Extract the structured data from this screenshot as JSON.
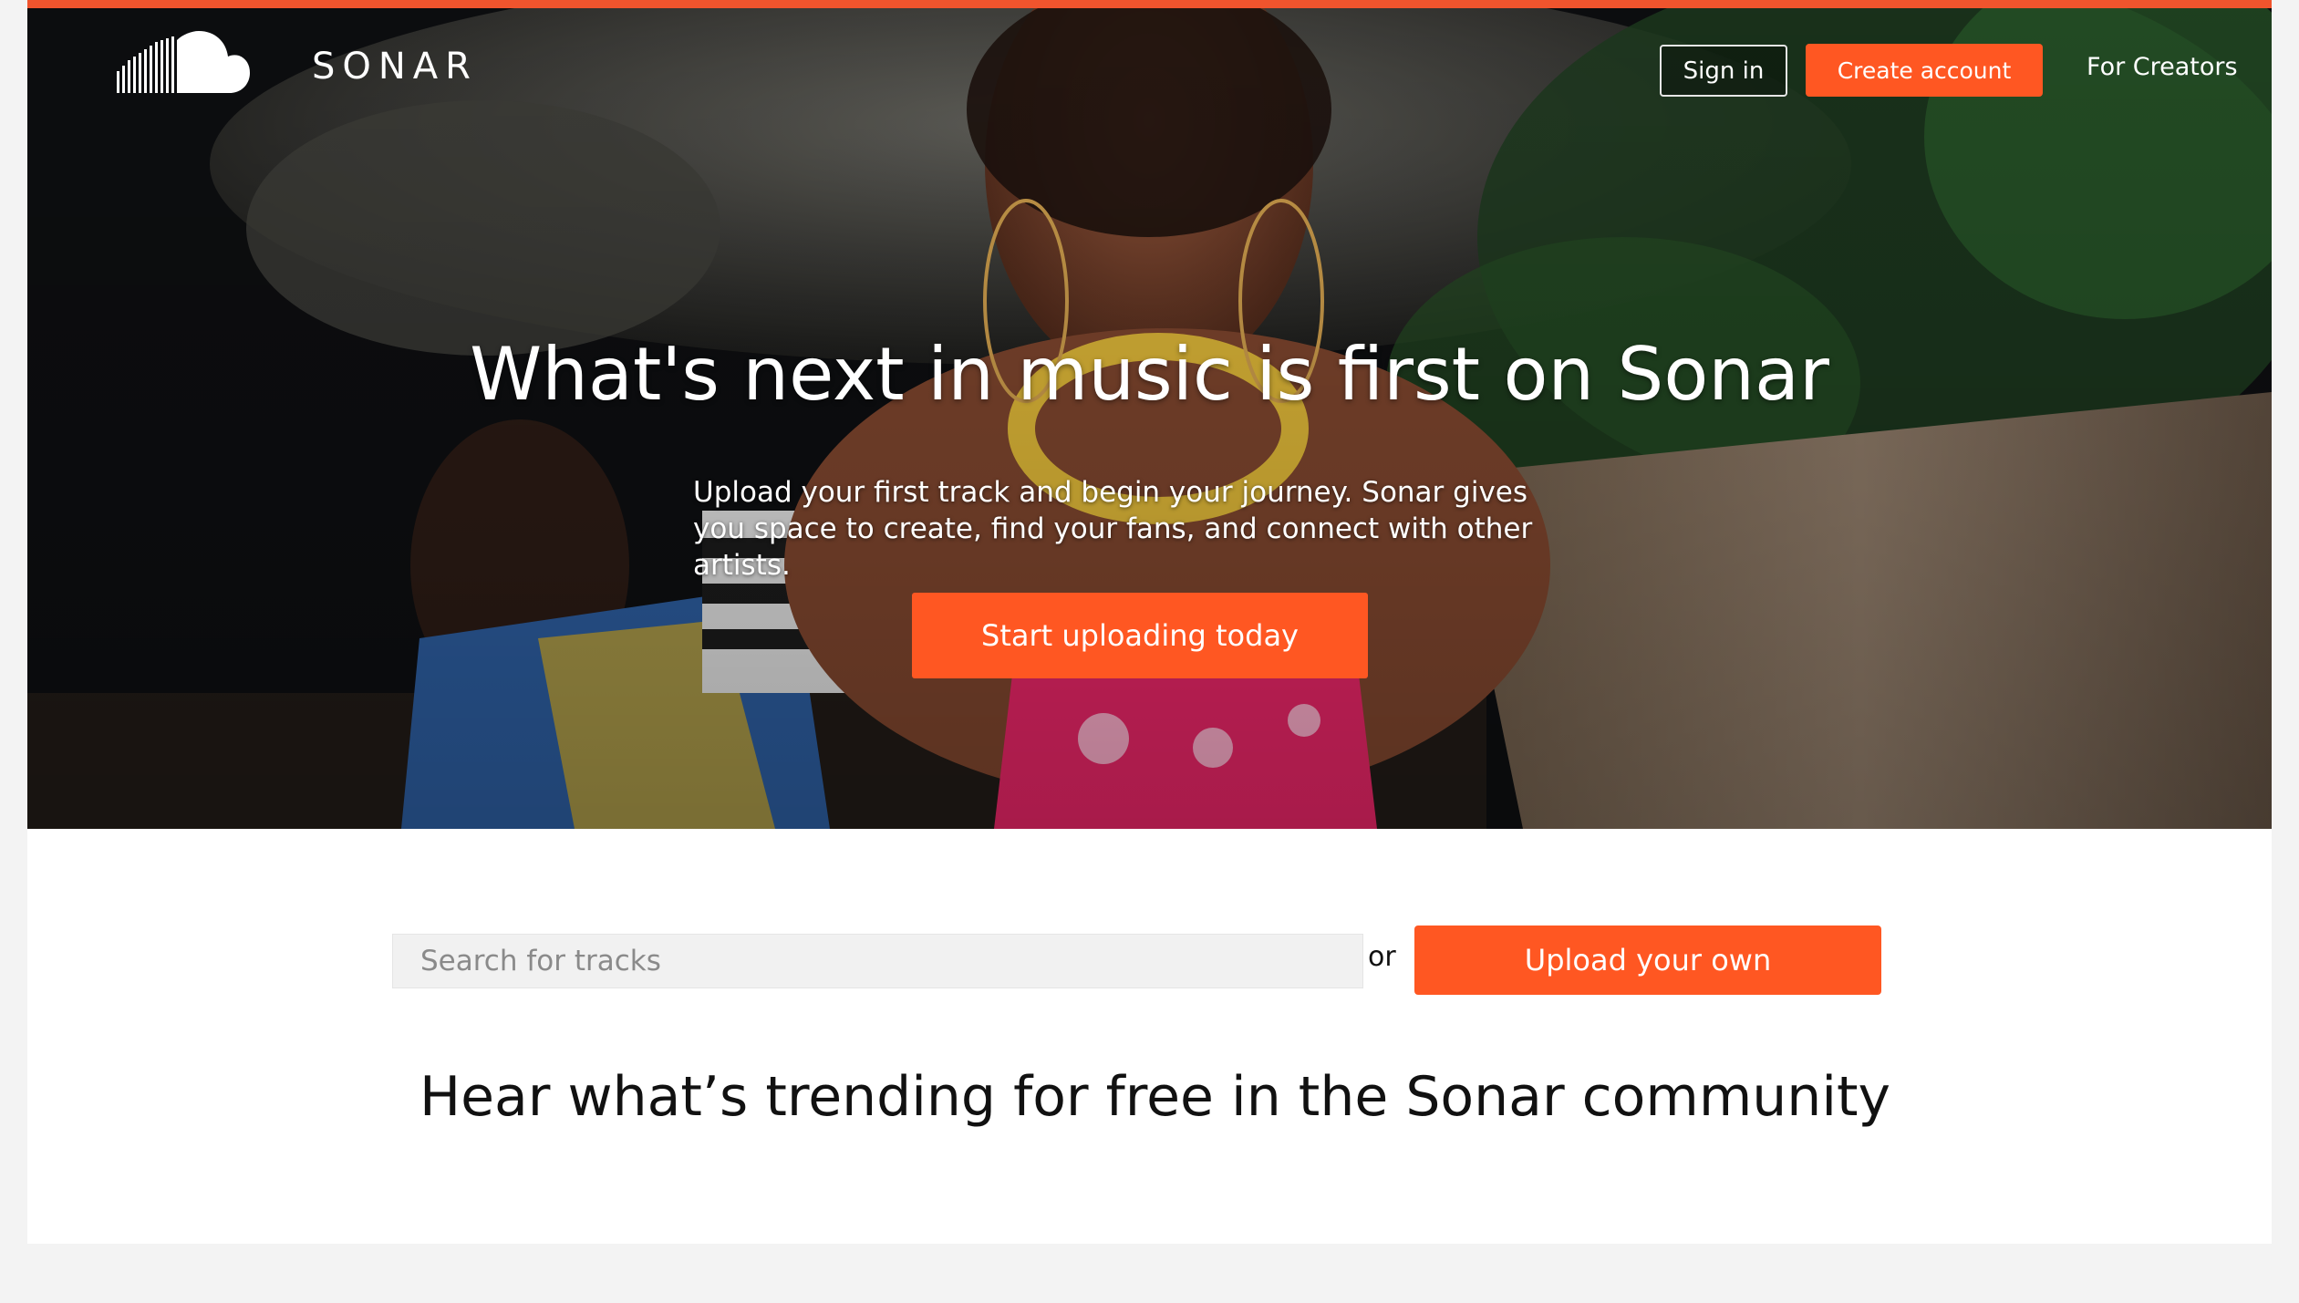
{
  "brand": {
    "name": "SONAR",
    "accent_color": "#ff5722",
    "top_bar_color": "#f0542d"
  },
  "nav": {
    "sign_in": "Sign in",
    "create_account": "Create account",
    "for_creators": "For Creators"
  },
  "hero": {
    "title": "What's next in music is first on Sonar",
    "subtitle": "Upload your first track and begin your journey. Sonar gives you space to create, find your fans, and connect with other artists.",
    "cta": "Start uploading today"
  },
  "search": {
    "placeholder": "Search for tracks",
    "value": "",
    "or_text": "or",
    "upload_button": "Upload your own"
  },
  "trending": {
    "heading": "Hear what’s trending for free in the Sonar community"
  },
  "icons": {
    "logo": "cloud-waveform-icon"
  }
}
